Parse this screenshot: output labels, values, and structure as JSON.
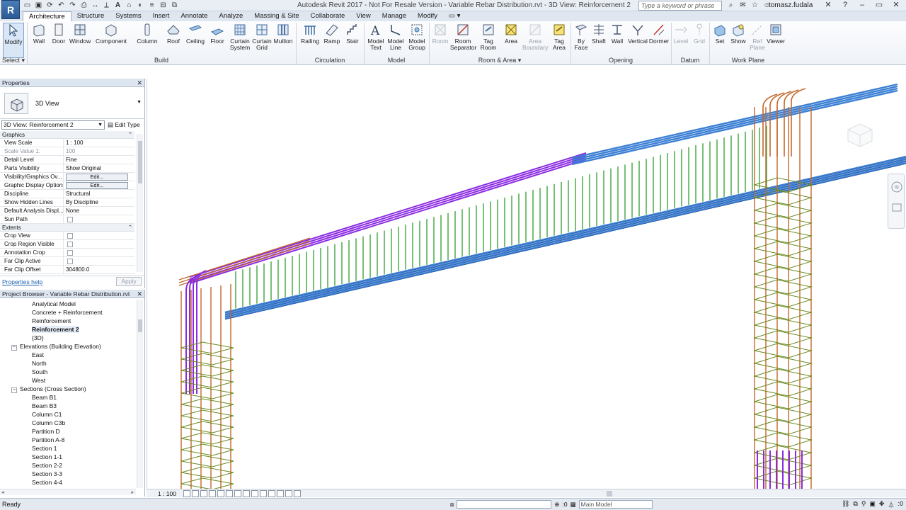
{
  "app": {
    "logo": "R",
    "window_title": "Autodesk Revit 2017 -   Not For Resale Version  -   Variable Rebar Distribution.rvt - 3D View: Reinforcement 2",
    "search_placeholder": "Type a keyword or phrase",
    "user": "tomasz.fudala",
    "accent": "#2d5a93"
  },
  "qat_icons": [
    "open-icon",
    "save-icon",
    "sync-icon",
    "undo-icon",
    "redo-icon",
    "print-icon",
    "measure-icon",
    "dimension-icon",
    "text-icon",
    "3d-view-icon",
    "section-icon",
    "thin-lines-icon",
    "close-hidden-icon",
    "switch-windows-icon"
  ],
  "ribbon": {
    "tabs": [
      "Architecture",
      "Structure",
      "Systems",
      "Insert",
      "Annotate",
      "Analyze",
      "Massing & Site",
      "Collaborate",
      "View",
      "Manage",
      "Modify"
    ],
    "active_tab": "Architecture",
    "tools": {
      "modify": "Modify",
      "wall": "Wall",
      "door": "Door",
      "window": "Window",
      "component": "Component",
      "column": "Column",
      "roof": "Roof",
      "ceiling": "Ceiling",
      "floor": "Floor",
      "curtain_system": "Curtain System",
      "curtain_grid": "Curtain Grid",
      "mullion": "Mullion",
      "railing": "Railing",
      "ramp": "Ramp",
      "stair": "Stair",
      "model_text": "Model Text",
      "model_line": "Model Line",
      "model_group": "Model Group",
      "room": "Room",
      "room_separator": "Room Separator",
      "tag_room": "Tag Room",
      "area": "Area",
      "area_boundary": "Area Boundary",
      "tag_area": "Tag Area",
      "by_face": "By Face",
      "shaft": "Shaft",
      "opening_wall": "Wall",
      "vertical": "Vertical",
      "dormer": "Dormer",
      "level": "Level",
      "grid": "Grid",
      "set": "Set",
      "show": "Show",
      "ref_plane": "Ref Plane",
      "viewer": "Viewer"
    },
    "panels": {
      "select": "Select",
      "build": "Build",
      "circulation": "Circulation",
      "model": "Model",
      "room_area": "Room & Area",
      "opening": "Opening",
      "datum": "Datum",
      "work_plane": "Work Plane"
    }
  },
  "properties": {
    "header": "Properties",
    "type_name": "3D View",
    "instance": "3D View: Reinforcement 2",
    "edit_type": "Edit Type",
    "groups": {
      "graphics": "Graphics",
      "extents": "Extents"
    },
    "graphics_rows": [
      {
        "name": "View Scale",
        "value": "1 : 100"
      },
      {
        "name": "Scale Value    1:",
        "value": "100"
      },
      {
        "name": "Detail Level",
        "value": "Fine"
      },
      {
        "name": "Parts Visibility",
        "value": "Show Original"
      },
      {
        "name": "Visibility/Graphics Ov...",
        "value": "Edit..."
      },
      {
        "name": "Graphic Display Options",
        "value": "Edit..."
      },
      {
        "name": "Discipline",
        "value": "Structural"
      },
      {
        "name": "Show Hidden Lines",
        "value": "By Discipline"
      },
      {
        "name": "Default Analysis Displ...",
        "value": "None"
      },
      {
        "name": "Sun Path",
        "value": ""
      }
    ],
    "extents_rows": [
      {
        "name": "Crop View",
        "value": ""
      },
      {
        "name": "Crop Region Visible",
        "value": ""
      },
      {
        "name": "Annotation Crop",
        "value": ""
      },
      {
        "name": "Far Clip Active",
        "value": ""
      },
      {
        "name": "Far Clip Offset",
        "value": "304800.0"
      }
    ],
    "help_link": "Properties help",
    "apply": "Apply"
  },
  "browser": {
    "header": "Project Browser - Variable Rebar Distribution.rvt",
    "items": [
      {
        "label": "Analytical Model",
        "level": 3
      },
      {
        "label": "Concrete + Reinforcement",
        "level": 3
      },
      {
        "label": "Reinforcement",
        "level": 3
      },
      {
        "label": "Reinforcement 2",
        "level": 3,
        "selected": true
      },
      {
        "label": "{3D}",
        "level": 3
      },
      {
        "label": "Elevations (Building Elevation)",
        "level": 2,
        "toggle": "−"
      },
      {
        "label": "East",
        "level": 3
      },
      {
        "label": "North",
        "level": 3
      },
      {
        "label": "South",
        "level": 3
      },
      {
        "label": "West",
        "level": 3
      },
      {
        "label": "Sections (Cross Section)",
        "level": 2,
        "toggle": "−"
      },
      {
        "label": "Beam B1",
        "level": 3
      },
      {
        "label": "Beam B3",
        "level": 3
      },
      {
        "label": "Column C1",
        "level": 3
      },
      {
        "label": "Column C3b",
        "level": 3
      },
      {
        "label": "Partition D",
        "level": 3
      },
      {
        "label": "Partition A-8",
        "level": 3
      },
      {
        "label": "Section 1",
        "level": 3
      },
      {
        "label": "Section 1-1",
        "level": 3
      },
      {
        "label": "Section 2-2",
        "level": 3
      },
      {
        "label": "Section 3-3",
        "level": 3
      },
      {
        "label": "Section 4-4",
        "level": 3
      }
    ]
  },
  "viewport": {
    "scale_label": "1 : 100",
    "colors": {
      "longitudinal": "#3b7fd4",
      "longitudinal_dark": "#1e4f9a",
      "top_bars": "#8a2be2",
      "stirrups": "#2e9e2e",
      "column_bars": "#c2682b",
      "column_ties": "#6a8a1e"
    }
  },
  "status": {
    "text": "Ready",
    "coord_label": ":0",
    "model": "Main Model",
    "filter_count": ":0"
  }
}
